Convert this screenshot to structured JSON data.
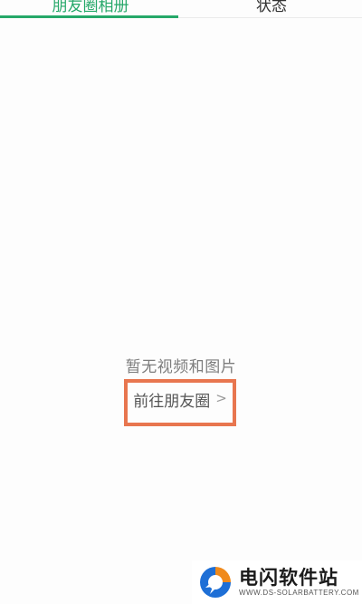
{
  "tabs": [
    {
      "label": "朋友圈相册",
      "active": true
    },
    {
      "label": "状态",
      "active": false
    }
  ],
  "accent_color": "#25a869",
  "highlight_color": "#e8764f",
  "empty_state": {
    "message": "暂无视频和图片",
    "link_label": "前往朋友圈",
    "link_icon": "chevron-right-icon"
  },
  "watermark": {
    "title": "电闪软件站",
    "subtitle": "WWW.DS-SOLARBATTERY.COM"
  }
}
